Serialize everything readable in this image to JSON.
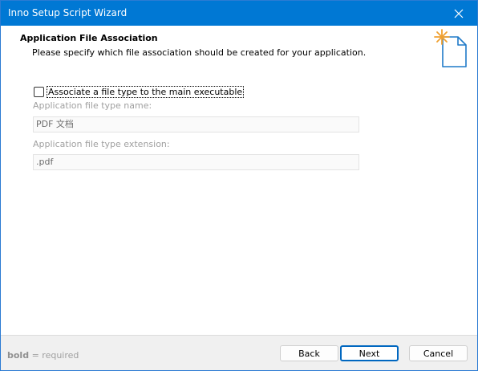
{
  "window": {
    "title": "Inno Setup Script Wizard"
  },
  "header": {
    "title": "Application File Association",
    "subtitle": "Please specify which file association should be created for your application."
  },
  "form": {
    "associate_checkbox_label": "Associate a file type to the main executable",
    "associate_checked": false,
    "file_type_name_label": "Application file type name:",
    "file_type_name_value": "PDF 文档",
    "file_type_extension_label": "Application file type extension:",
    "file_type_extension_value": ".pdf"
  },
  "footer": {
    "hint_bold": "bold",
    "hint_rest": " = required",
    "back_label": "Back",
    "next_label": "Next",
    "cancel_label": "Cancel"
  },
  "colors": {
    "titlebar": "#0078d4",
    "accent": "#0067c0",
    "star_orange": "#f0a030",
    "doc_blue": "#1f7ac8"
  },
  "icons": {
    "close": "close-icon",
    "wizard": "new-document-star-icon"
  }
}
